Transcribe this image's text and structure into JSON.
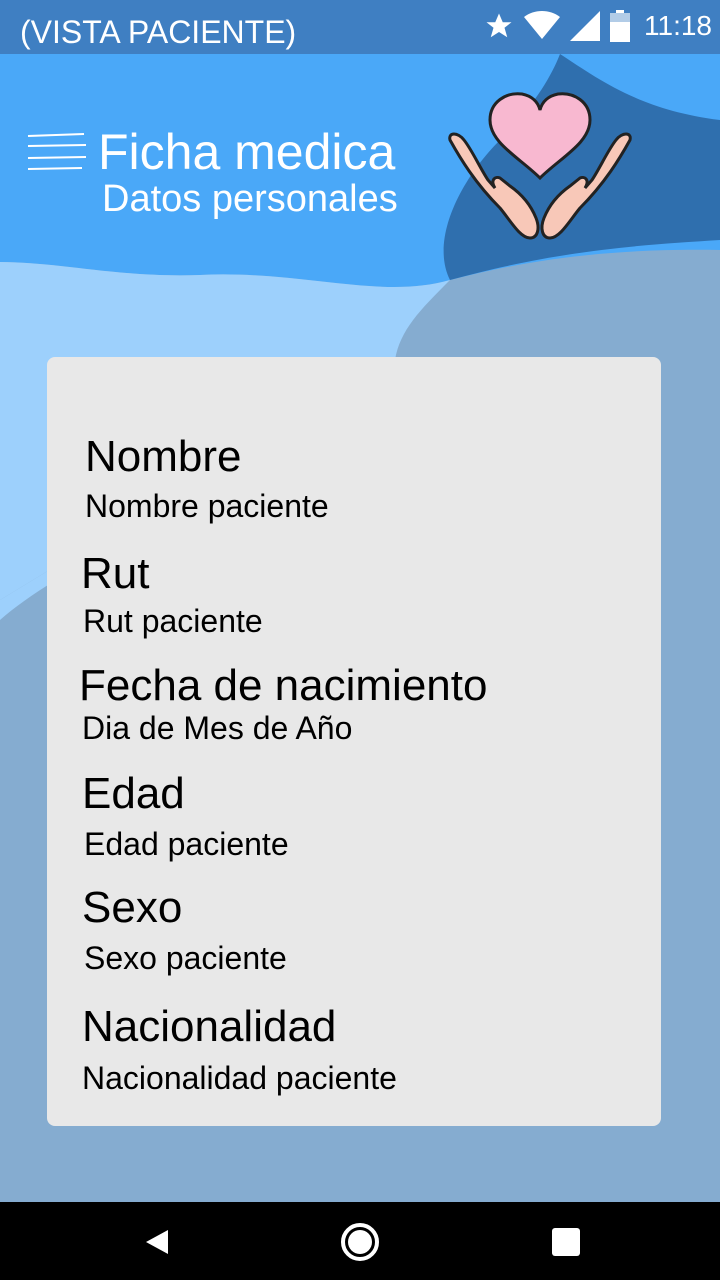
{
  "status_bar": {
    "title": "(VISTA PACIENTE)",
    "time": "11:18",
    "icons": [
      "star-icon",
      "wifi-icon",
      "signal-icon",
      "battery-icon"
    ]
  },
  "header": {
    "menu_icon": "hamburger-menu-icon",
    "title": "Ficha medica",
    "subtitle": "Datos personales",
    "logo": "heart-in-hands-icon"
  },
  "fields": [
    {
      "label": "Nombre",
      "value": "Nombre paciente"
    },
    {
      "label": "Rut",
      "value": "Rut paciente"
    },
    {
      "label": "Fecha de nacimiento",
      "value": "Dia de Mes de Año"
    },
    {
      "label": "Edad",
      "value": "Edad paciente"
    },
    {
      "label": "Sexo",
      "value": "Sexo paciente"
    },
    {
      "label": "Nacionalidad",
      "value": "Nacionalidad paciente"
    }
  ],
  "navigation": [
    "back-icon",
    "home-icon",
    "recents-icon"
  ],
  "colors": {
    "status_bar": "#3f7fc2",
    "header_blue": "#4aa8f8",
    "dark_blue": "#2f6fae",
    "light_blue": "#9dd0fc",
    "background": "#85acd0",
    "card": "#e8e8e8",
    "heart": "#f8b8d0",
    "hands": "#f8c8b8"
  }
}
